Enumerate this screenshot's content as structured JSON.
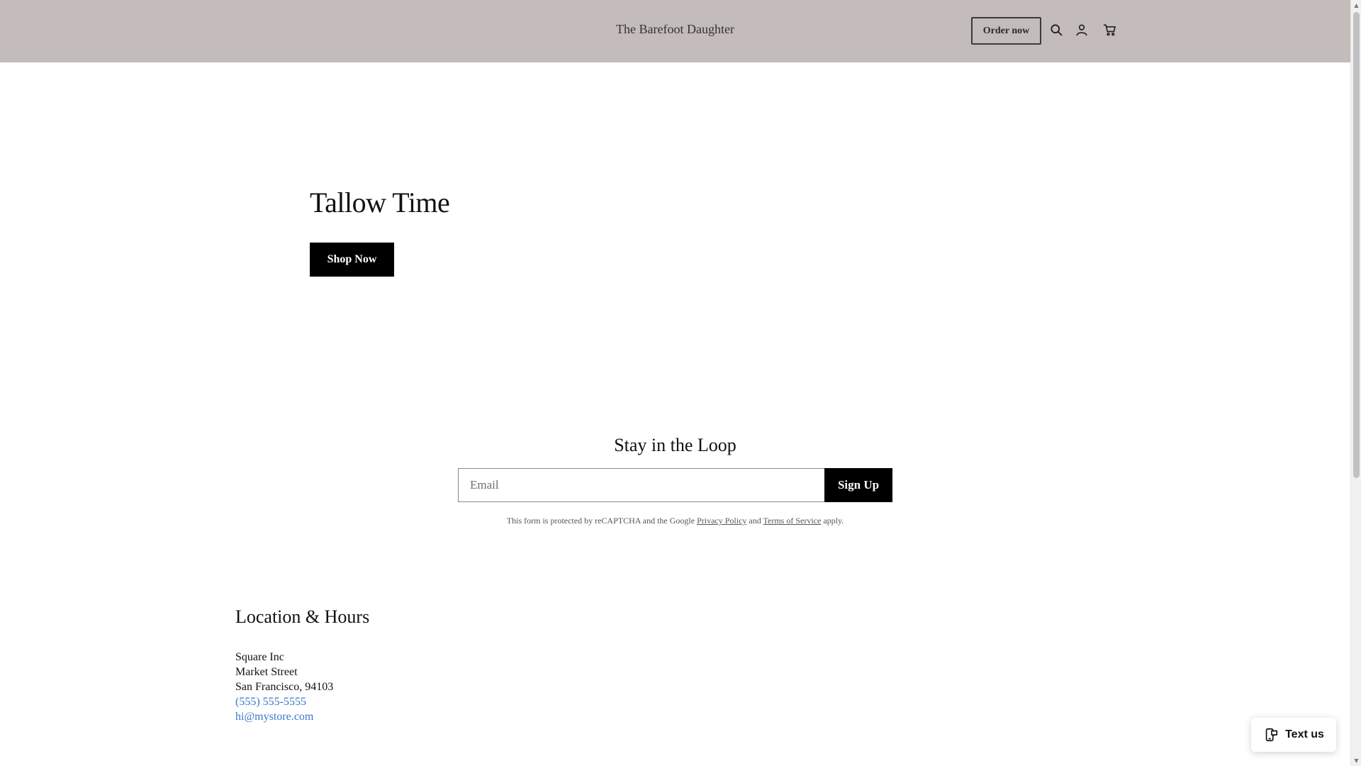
{
  "header": {
    "brand": "The Barefoot Daughter",
    "order_label": "Order now",
    "icons": [
      "search-icon",
      "account-icon",
      "cart-icon"
    ]
  },
  "hero": {
    "title": "Tallow Time",
    "cta_label": "Shop Now"
  },
  "newsletter": {
    "title": "Stay in the Loop",
    "email_placeholder": "Email",
    "email_value": "",
    "signup_label": "Sign Up",
    "legal_prefix": "This form is protected by reCAPTCHA and the Google ",
    "privacy_label": "Privacy Policy",
    "legal_and": " and ",
    "terms_label": "Terms of Service",
    "legal_suffix": " apply."
  },
  "location": {
    "title": "Location & Hours",
    "name": "Square Inc",
    "street": "Market Street",
    "city": "San Francisco, 94103",
    "phone": "(555) 555-5555",
    "email": "hi@mystore.com"
  },
  "widget": {
    "label": "Text us",
    "icon": "chat-phone-icon"
  },
  "colors": {
    "header_bg": "#c4bbbb",
    "button_bg": "#000000",
    "link": "#3a79c8"
  }
}
